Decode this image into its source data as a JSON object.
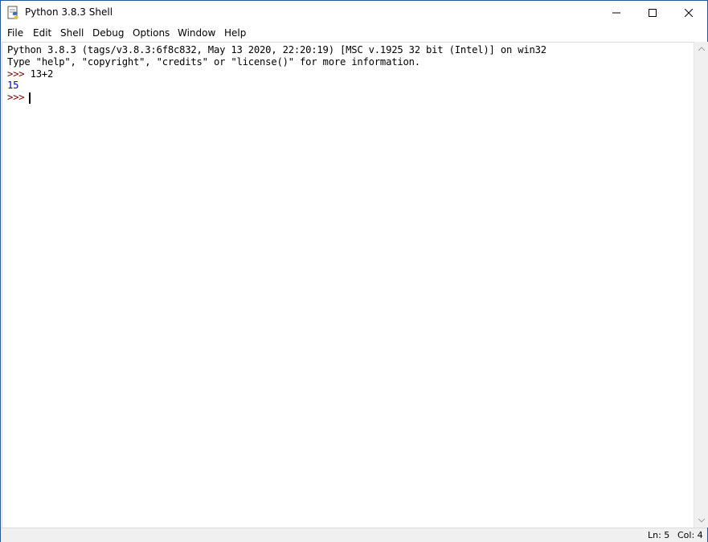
{
  "window": {
    "title": "Python 3.8.3 Shell",
    "icon": "python-idle-icon",
    "controls": [
      "minimize-icon",
      "maximize-icon",
      "close-icon"
    ]
  },
  "menubar": {
    "items": [
      "File",
      "Edit",
      "Shell",
      "Debug",
      "Options",
      "Window",
      "Help"
    ]
  },
  "shell": {
    "banner_line1": "Python 3.8.3 (tags/v3.8.3:6f8c832, May 13 2020, 22:20:19) [MSC v.1925 32 bit (Intel)] on win32",
    "banner_line2": "Type \"help\", \"copyright\", \"credits\" or \"license()\" for more information.",
    "prompt": ">>> ",
    "input1": "13+2",
    "output1": "15",
    "prompt2": ">>> "
  },
  "colors": {
    "prompt": "#770000",
    "output": "#0000c0",
    "border": "#2b5797"
  },
  "statusbar": {
    "line": "Ln: 5",
    "col": "Col: 4"
  }
}
